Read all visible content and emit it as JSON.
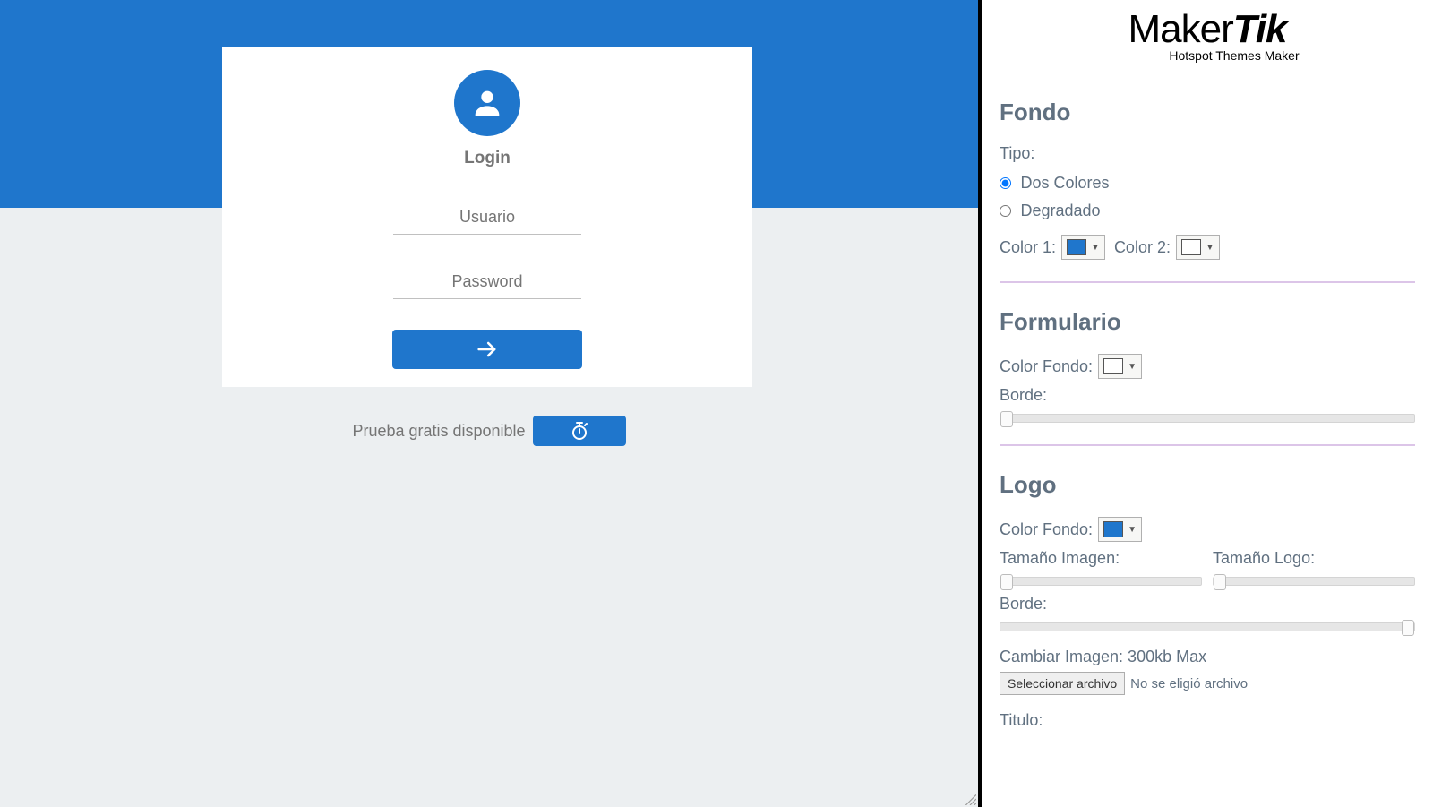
{
  "preview": {
    "login_title": "Login",
    "username_placeholder": "Usuario",
    "password_placeholder": "Password",
    "trial_text": "Prueba gratis disponible"
  },
  "brand": {
    "name_part1": "Maker",
    "name_part2": "Tik",
    "tagline": "Hotspot Themes Maker"
  },
  "colors": {
    "primary": "#1f76cc",
    "white": "#ffffff"
  },
  "settings": {
    "fondo": {
      "title": "Fondo",
      "tipo_label": "Tipo:",
      "option_dos_colores": "Dos Colores",
      "option_degradado": "Degradado",
      "color1_label": "Color 1:",
      "color2_label": "Color 2:"
    },
    "formulario": {
      "title": "Formulario",
      "color_fondo_label": "Color Fondo:",
      "borde_label": "Borde:"
    },
    "logo": {
      "title": "Logo",
      "color_fondo_label": "Color Fondo:",
      "tamano_imagen_label": "Tamaño Imagen:",
      "tamano_logo_label": "Tamaño Logo:",
      "borde_label": "Borde:",
      "cambiar_imagen_label": "Cambiar Imagen: 300kb Max",
      "file_button": "Seleccionar archivo",
      "file_status": "No se eligió archivo",
      "titulo_label": "Titulo:"
    }
  }
}
